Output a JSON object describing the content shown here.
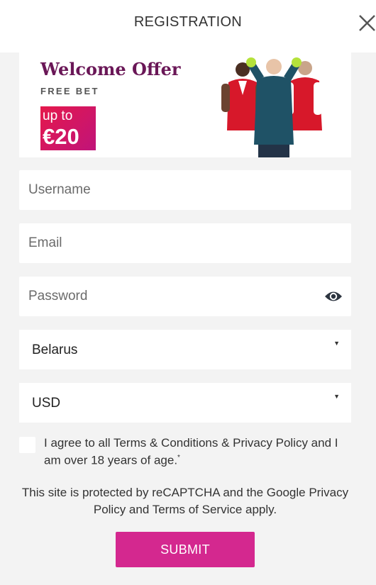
{
  "header": {
    "title": "REGISTRATION",
    "close_icon": "close-icon"
  },
  "banner": {
    "offer": "Welcome Offer",
    "subtitle": "FREE BET",
    "badge_upto": "up to",
    "badge_amount": "€20",
    "colors": {
      "offer": "#6a1757",
      "badge_from": "#e5184b",
      "badge_to": "#c0147a"
    }
  },
  "form": {
    "username_placeholder": "Username",
    "email_placeholder": "Email",
    "password_placeholder": "Password",
    "password_icon": "eye-icon",
    "country": "Belarus",
    "currency": "USD",
    "agree_text": "I agree to all Terms & Conditions & Privacy Policy and I am over 18 years of age.",
    "agree_mark": "*",
    "recaptcha_text": "This site is protected by reCAPTCHA and the Google Privacy Policy and Terms of Service apply.",
    "submit_label": "SUBMIT"
  },
  "colors": {
    "accent": "#d4288f",
    "background": "#f3f3f3"
  }
}
